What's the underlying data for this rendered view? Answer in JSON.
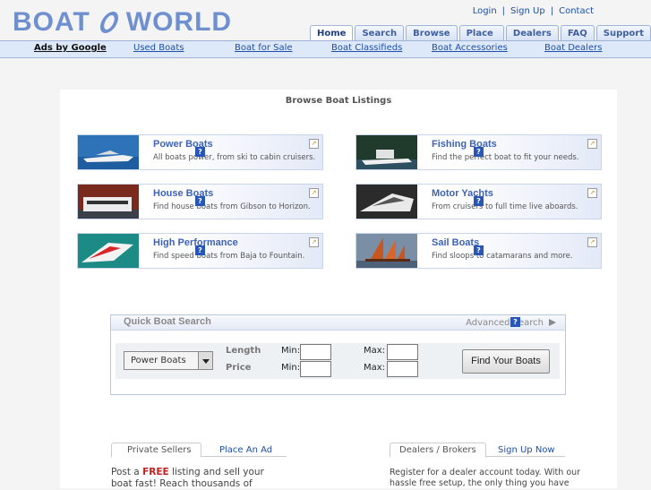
{
  "header": {
    "logo_left": "BOAT",
    "logo_right": "WORLD",
    "links": [
      "Login",
      "Sign Up",
      "Contact"
    ],
    "tabs": [
      "Home",
      "Search",
      "Browse",
      "Place Ad",
      "Dealers",
      "FAQ",
      "Support"
    ],
    "active_tab": "Home"
  },
  "navbar": {
    "ads_label": "Ads by Google",
    "links": [
      "Used Boats",
      "Boat for Sale",
      "Boat Classifieds",
      "Boat Accessories",
      "Boat Dealers"
    ]
  },
  "browse": {
    "title": "Browse Boat Listings",
    "help_mark": "?",
    "arrow_mark": "↗",
    "categories": [
      {
        "title": "Power Boats",
        "desc": "All boats power, from ski to cabin cruisers."
      },
      {
        "title": "Fishing Boats",
        "desc": "Find the perfect boat to fit your needs."
      },
      {
        "title": "House Boats",
        "desc": "Find house boats from Gibson to Horizon."
      },
      {
        "title": "Motor Yachts",
        "desc": "From cruisers to full time live aboards."
      },
      {
        "title": "High Performance",
        "desc": "Find speed boats from Baja to Fountain."
      },
      {
        "title": "Sail Boats",
        "desc": "Find sloops to catamarans and more."
      }
    ]
  },
  "quick_search": {
    "title": "Quick Boat Search",
    "advanced_label": "Advanced Search",
    "type_value": "Power Boats",
    "length_label": "Length",
    "price_label": "Price",
    "min_label": "Min:",
    "max_label": "Max:",
    "length_min": "",
    "length_max": "",
    "price_min": "",
    "price_max": "",
    "submit_label": "Find Your Boats"
  },
  "sellers": {
    "tab_active": "Private Sellers",
    "tab_other": "Place An Ad",
    "line1_before": "Post a ",
    "line1_free": "FREE",
    "line1_after": " listing and sell your",
    "line2": "boat fast! Reach thousands of"
  },
  "dealers": {
    "tab_active": "Dealers / Brokers",
    "tab_other": "Sign Up Now",
    "line1": "Register for a dealer account today. With our",
    "line2": "hassle free setup, the only thing you have"
  }
}
